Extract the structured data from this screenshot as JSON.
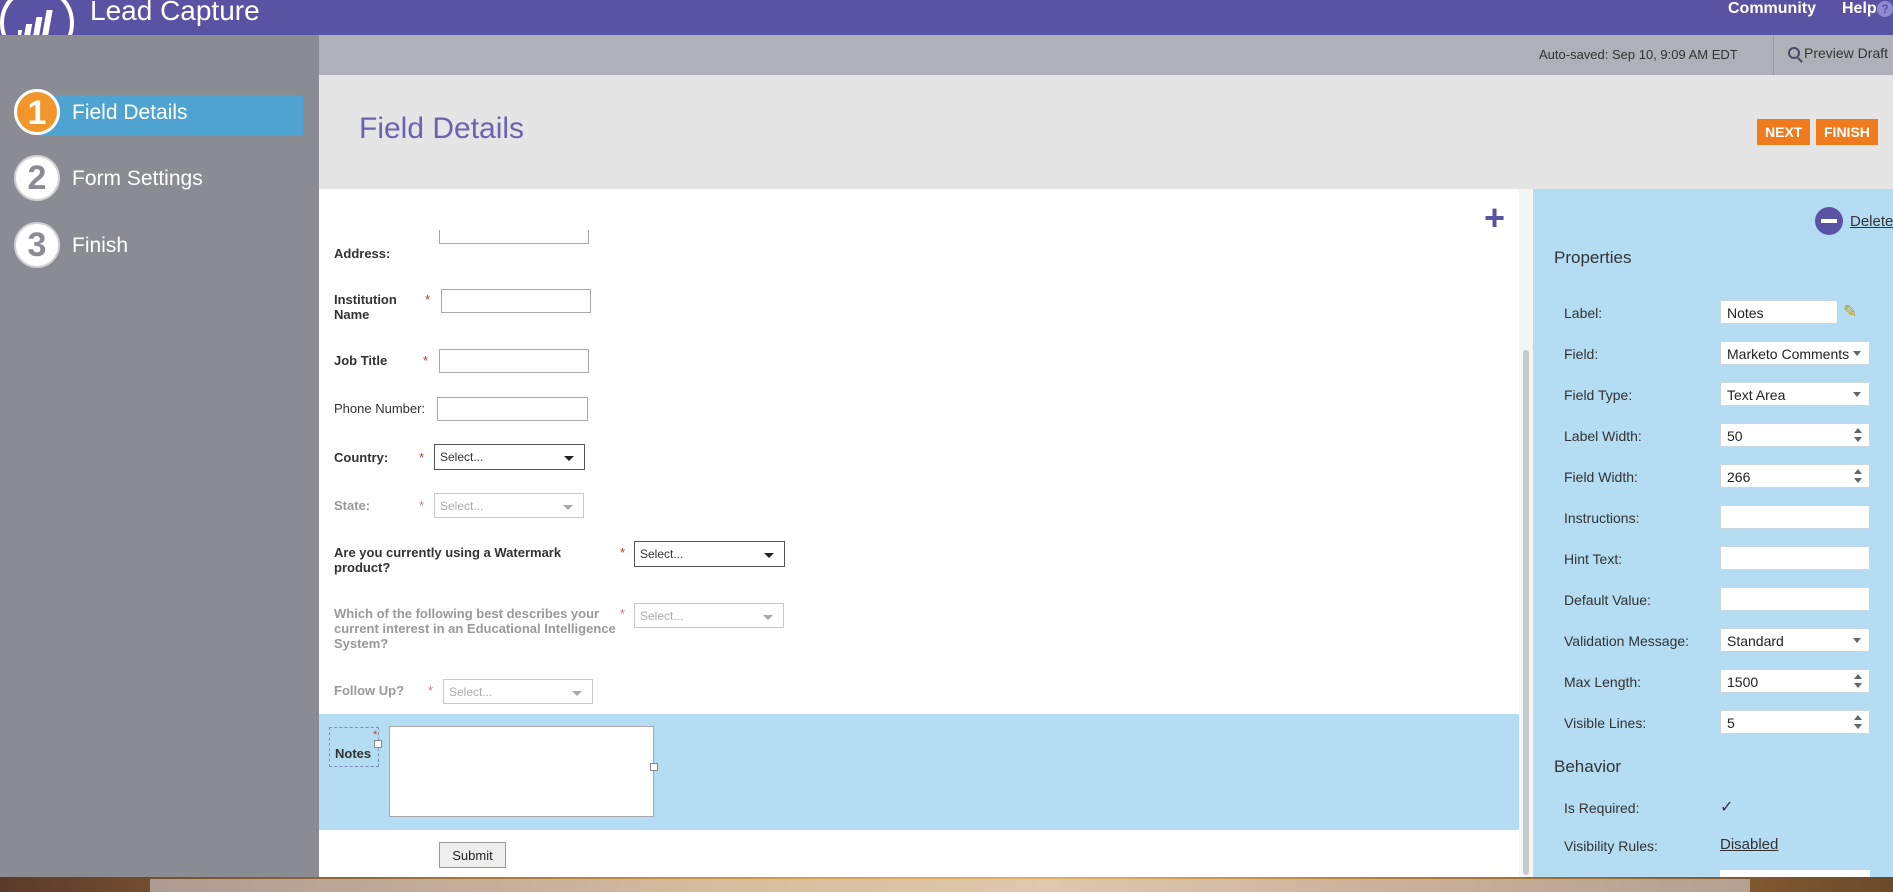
{
  "header": {
    "app_title": "Lead Capture",
    "community_link": "Community",
    "help_link": "Help",
    "help_icon": "?"
  },
  "sidebar": {
    "steps": [
      {
        "number": "1",
        "label": "Field Details",
        "active": true
      },
      {
        "number": "2",
        "label": "Form Settings",
        "active": false
      },
      {
        "number": "3",
        "label": "Finish",
        "active": false
      }
    ]
  },
  "subheader": {
    "autosave": "Auto-saved: Sep 10, 9:09 AM EDT",
    "preview_label": "Preview Draft"
  },
  "content": {
    "title": "Field Details",
    "next_label": "NEXT",
    "finish_label": "FINISH",
    "add_icon": "+"
  },
  "form": {
    "address_label": "Address:",
    "institution_label": "Institution Name",
    "job_title_label": "Job Title",
    "phone_label": "Phone Number:",
    "country_label": "Country:",
    "country_value": "Select...",
    "state_label": "State:",
    "state_value": "Select...",
    "watermark_label": "Are you currently using a Watermark product?",
    "watermark_value": "Select...",
    "interest_label": "Which of the following best describes your current interest in an Educational Intelligence System?",
    "interest_value": "Select...",
    "followup_label": "Follow Up?",
    "followup_value": "Select...",
    "notes_label": "Notes",
    "required_mark": "*",
    "submit_label": "Submit"
  },
  "properties": {
    "delete_label": "Delete",
    "section_title": "Properties",
    "label_label": "Label:",
    "label_value": "Notes",
    "field_label": "Field:",
    "field_value": "Marketo Comments",
    "field_type_label": "Field Type:",
    "field_type_value": "Text Area",
    "label_width_label": "Label Width:",
    "label_width_value": "50",
    "field_width_label": "Field Width:",
    "field_width_value": "266",
    "instructions_label": "Instructions:",
    "instructions_value": "",
    "hint_label": "Hint Text:",
    "hint_value": "",
    "default_label": "Default Value:",
    "default_value": "",
    "validation_label": "Validation Message:",
    "validation_value": "Standard",
    "max_length_label": "Max Length:",
    "max_length_value": "1500",
    "visible_lines_label": "Visible Lines:",
    "visible_lines_value": "5",
    "behavior_title": "Behavior",
    "required_label": "Is Required:",
    "required_check": "✓",
    "visibility_label": "Visibility Rules:",
    "visibility_value": "Disabled"
  },
  "colors": {
    "brand_purple": "#5a53a4",
    "accent_orange": "#ef7b1c",
    "active_step_blue": "#4fa3d1",
    "panel_blue": "#b4dcf3"
  }
}
